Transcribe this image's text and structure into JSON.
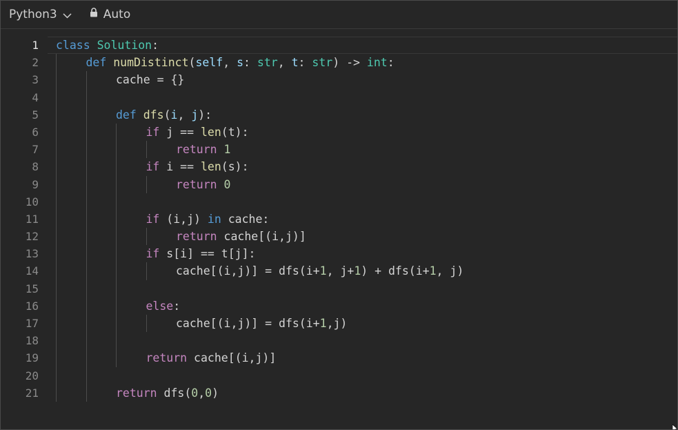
{
  "toolbar": {
    "language": "Python3",
    "mode": "Auto"
  },
  "colors": {
    "background": "#262626",
    "keyword": "#c586c0",
    "keyword_blue": "#569cd6",
    "class_name": "#4ec9b0",
    "function_name": "#dcdcaa",
    "number": "#b5cea8",
    "parameter": "#9cdcfe",
    "plain": "#d4d4d4",
    "line_number": "#8a8a8a"
  },
  "editor": {
    "active_line": 1,
    "lines": [
      {
        "n": "1",
        "indent": 0,
        "tokens": [
          {
            "t": "class",
            "c": "kwb"
          },
          {
            "t": " "
          },
          {
            "t": "Solution",
            "c": "cls"
          },
          {
            "t": ":"
          }
        ]
      },
      {
        "n": "2",
        "indent": 1,
        "tokens": [
          {
            "t": "def",
            "c": "kwb"
          },
          {
            "t": " "
          },
          {
            "t": "numDistinct",
            "c": "fn"
          },
          {
            "t": "("
          },
          {
            "t": "self",
            "c": "prm"
          },
          {
            "t": ", "
          },
          {
            "t": "s",
            "c": "prm"
          },
          {
            "t": ": "
          },
          {
            "t": "str",
            "c": "cls"
          },
          {
            "t": ", "
          },
          {
            "t": "t",
            "c": "prm"
          },
          {
            "t": ": "
          },
          {
            "t": "str",
            "c": "cls"
          },
          {
            "t": ") -> "
          },
          {
            "t": "int",
            "c": "cls"
          },
          {
            "t": ":"
          }
        ]
      },
      {
        "n": "3",
        "indent": 2,
        "tokens": [
          {
            "t": "cache = {}"
          }
        ]
      },
      {
        "n": "4",
        "indent": 2,
        "tokens": []
      },
      {
        "n": "5",
        "indent": 2,
        "tokens": [
          {
            "t": "def",
            "c": "kwb"
          },
          {
            "t": " "
          },
          {
            "t": "dfs",
            "c": "fn"
          },
          {
            "t": "("
          },
          {
            "t": "i",
            "c": "prm"
          },
          {
            "t": ", "
          },
          {
            "t": "j",
            "c": "prm"
          },
          {
            "t": "):"
          }
        ]
      },
      {
        "n": "6",
        "indent": 3,
        "tokens": [
          {
            "t": "if",
            "c": "kw"
          },
          {
            "t": " j == "
          },
          {
            "t": "len",
            "c": "fn"
          },
          {
            "t": "(t):"
          }
        ]
      },
      {
        "n": "7",
        "indent": 4,
        "tokens": [
          {
            "t": "return",
            "c": "kw"
          },
          {
            "t": " "
          },
          {
            "t": "1",
            "c": "num"
          }
        ]
      },
      {
        "n": "8",
        "indent": 3,
        "tokens": [
          {
            "t": "if",
            "c": "kw"
          },
          {
            "t": " i == "
          },
          {
            "t": "len",
            "c": "fn"
          },
          {
            "t": "(s):"
          }
        ]
      },
      {
        "n": "9",
        "indent": 4,
        "tokens": [
          {
            "t": "return",
            "c": "kw"
          },
          {
            "t": " "
          },
          {
            "t": "0",
            "c": "num"
          }
        ]
      },
      {
        "n": "10",
        "indent": 3,
        "tokens": []
      },
      {
        "n": "11",
        "indent": 3,
        "tokens": [
          {
            "t": "if",
            "c": "kw"
          },
          {
            "t": " (i,j) "
          },
          {
            "t": "in",
            "c": "kwb"
          },
          {
            "t": " cache:"
          }
        ]
      },
      {
        "n": "12",
        "indent": 4,
        "tokens": [
          {
            "t": "return",
            "c": "kw"
          },
          {
            "t": " cache[(i,j)]"
          }
        ]
      },
      {
        "n": "13",
        "indent": 3,
        "tokens": [
          {
            "t": "if",
            "c": "kw"
          },
          {
            "t": " s[i] == t[j]:"
          }
        ]
      },
      {
        "n": "14",
        "indent": 4,
        "tokens": [
          {
            "t": "cache[(i,j)] = dfs(i+"
          },
          {
            "t": "1",
            "c": "num"
          },
          {
            "t": ", j+"
          },
          {
            "t": "1",
            "c": "num"
          },
          {
            "t": ") + dfs(i+"
          },
          {
            "t": "1",
            "c": "num"
          },
          {
            "t": ", j)"
          }
        ]
      },
      {
        "n": "15",
        "indent": 3,
        "tokens": []
      },
      {
        "n": "16",
        "indent": 3,
        "tokens": [
          {
            "t": "else",
            "c": "kw"
          },
          {
            "t": ":"
          }
        ]
      },
      {
        "n": "17",
        "indent": 4,
        "tokens": [
          {
            "t": "cache[(i,j)] = dfs(i+"
          },
          {
            "t": "1",
            "c": "num"
          },
          {
            "t": ",j)"
          }
        ]
      },
      {
        "n": "18",
        "indent": 3,
        "tokens": []
      },
      {
        "n": "19",
        "indent": 3,
        "tokens": [
          {
            "t": "return",
            "c": "kw"
          },
          {
            "t": " cache[(i,j)]"
          }
        ]
      },
      {
        "n": "20",
        "indent": 2,
        "tokens": []
      },
      {
        "n": "21",
        "indent": 2,
        "tokens": [
          {
            "t": "return",
            "c": "kw"
          },
          {
            "t": " dfs("
          },
          {
            "t": "0",
            "c": "num"
          },
          {
            "t": ","
          },
          {
            "t": "0",
            "c": "num"
          },
          {
            "t": ")"
          }
        ]
      }
    ]
  }
}
